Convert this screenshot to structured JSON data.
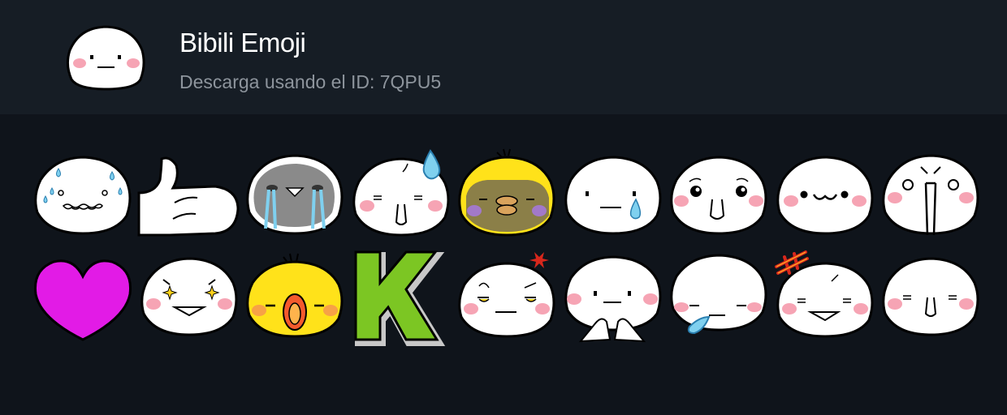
{
  "pack": {
    "title": "Bibili Emoji",
    "subtitle": "Descarga usando el ID: 7QPU5",
    "icon": "neutral-face-icon"
  },
  "stickers": [
    "sweating-worried-face-sticker",
    "thumbs-up-sticker",
    "crying-face-sticker",
    "sweat-drop-face-sticker",
    "yellow-chick-face-sticker",
    "single-tear-face-sticker",
    "teary-eyed-face-sticker",
    "cute-mouth-face-sticker",
    "shocked-face-sticker",
    "purple-heart-sticker",
    "sparkle-eyes-face-sticker",
    "yellow-chick-yelling-sticker",
    "green-letter-k-sticker",
    "annoyed-face-sticker",
    "praying-hands-face-sticker",
    "sleepy-drool-face-sticker",
    "angry-mark-face-sticker",
    "plain-smile-face-sticker"
  ],
  "colors": {
    "background": "#0f141b",
    "header": "#161d25",
    "blush": "#f6a4b4",
    "tear": "#7fd0ef",
    "chick_yellow": "#ffe21a",
    "heart": "#e21be6",
    "k_green": "#7cc623",
    "anger": "#d8271c"
  }
}
